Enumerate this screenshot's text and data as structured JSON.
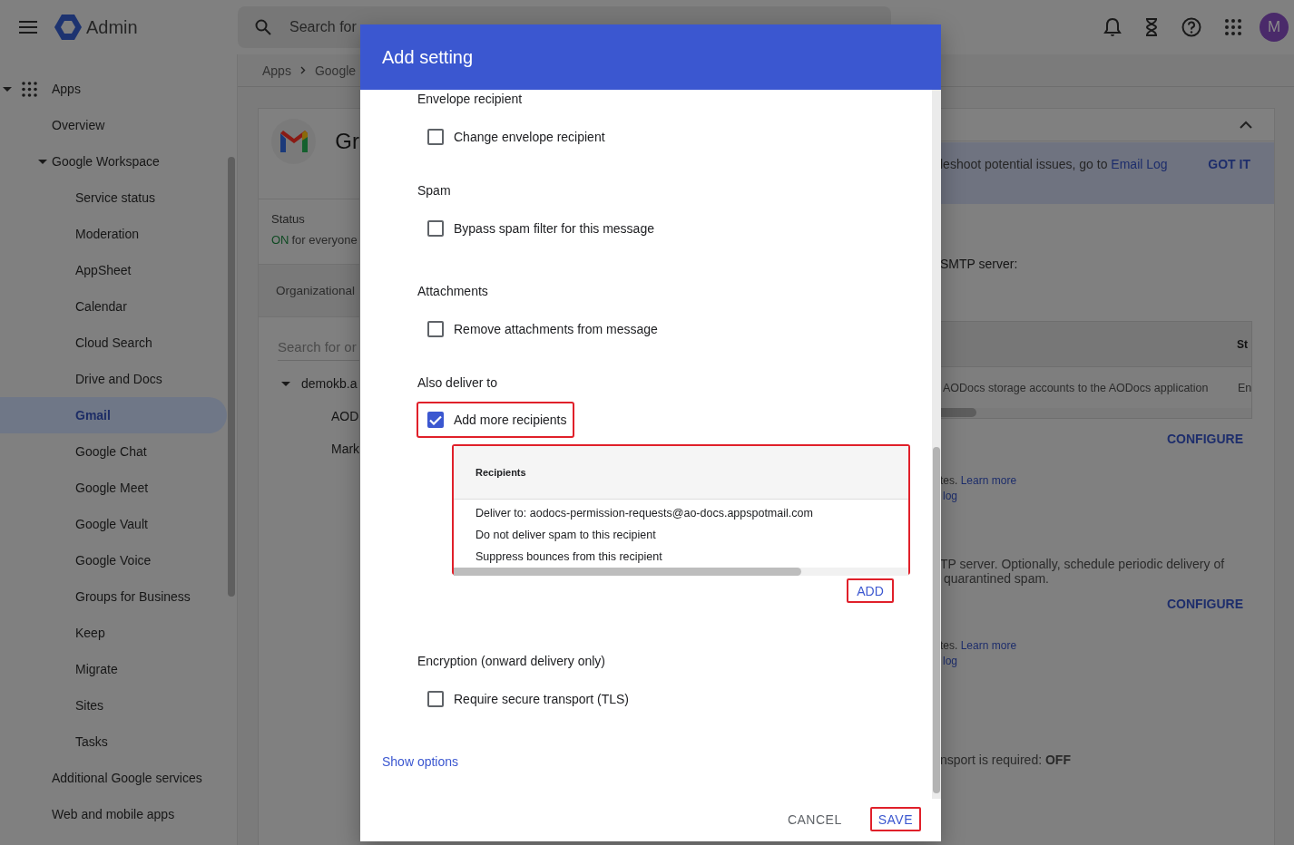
{
  "topbar": {
    "product": "Admin",
    "search": {
      "placeholder": "Search for"
    },
    "avatar": "M"
  },
  "sidebar": {
    "items": [
      {
        "label": "Apps",
        "expanded": true,
        "selected": false,
        "children": [
          {
            "label": "Overview",
            "selected": false
          },
          {
            "label": "Google Workspace",
            "expanded": true,
            "selected": false,
            "children": [
              {
                "label": "Service status",
                "selected": false
              },
              {
                "label": "Moderation",
                "selected": false
              },
              {
                "label": "AppSheet",
                "selected": false
              },
              {
                "label": "Calendar",
                "selected": false
              },
              {
                "label": "Cloud Search",
                "selected": false
              },
              {
                "label": "Drive and Docs",
                "selected": false
              },
              {
                "label": "Gmail",
                "selected": true
              },
              {
                "label": "Google Chat",
                "selected": false
              },
              {
                "label": "Google Meet",
                "selected": false
              },
              {
                "label": "Google Vault",
                "selected": false
              },
              {
                "label": "Google Voice",
                "selected": false
              },
              {
                "label": "Groups for Business",
                "selected": false
              },
              {
                "label": "Keep",
                "selected": false
              },
              {
                "label": "Migrate",
                "selected": false
              },
              {
                "label": "Sites",
                "selected": false
              },
              {
                "label": "Tasks",
                "selected": false
              }
            ]
          },
          {
            "label": "Additional Google services",
            "selected": false
          },
          {
            "label": "Web and mobile apps",
            "selected": false
          }
        ]
      }
    ]
  },
  "breadcrumb": [
    "Apps",
    "Google"
  ],
  "app": {
    "title": "Gr",
    "status": {
      "label": "Status",
      "state": "ON",
      "text": "for everyone"
    },
    "org_units": {
      "title": "Organizational",
      "search": {
        "placeholder": "Search for or"
      },
      "tree": [
        {
          "label": "demokb.a",
          "expanded": true,
          "children": [
            {
              "label": "AOD"
            },
            {
              "label": "Mark"
            }
          ]
        }
      ]
    }
  },
  "settings": {
    "banner": {
      "text": "leshoot potential issues, go to ",
      "link": "Email Log",
      "action": "GOT IT"
    },
    "smtp_label": "SMTP server:",
    "table": {
      "columns": [
        "",
        "St"
      ],
      "rows": [
        [
          "AODocs storage accounts to the AODocs application",
          "En"
        ]
      ]
    },
    "items": [
      {
        "kind": "action",
        "label": "CONFIGURE"
      },
      {
        "kind": "note",
        "text": "tes. ",
        "link": "Learn more",
        "second_link": "log"
      },
      {
        "kind": "text",
        "lines": [
          "TP server. Optionally, schedule periodic delivery of",
          "quarantined spam."
        ]
      },
      {
        "kind": "action",
        "label": "CONFIGURE"
      },
      {
        "kind": "note",
        "text": "tes. ",
        "link": "Learn more",
        "second_link": "log"
      },
      {
        "kind": "text",
        "lines": [
          "nsport is required: **OFF**"
        ]
      }
    ]
  },
  "dialog": {
    "title": "Add setting",
    "groups": [
      {
        "heading": "Envelope recipient",
        "option": {
          "label": "Change envelope recipient",
          "checked": false,
          "highlighted": false
        }
      },
      {
        "heading": "Spam",
        "option": {
          "label": "Bypass spam filter for this message",
          "checked": false,
          "highlighted": false
        }
      },
      {
        "heading": "Attachments",
        "option": {
          "label": "Remove attachments from message",
          "checked": false,
          "highlighted": false
        }
      },
      {
        "heading": "Also deliver to",
        "option": {
          "label": "Add more recipients",
          "checked": true,
          "highlighted": true
        },
        "recipients": {
          "header": "Recipients",
          "highlighted": true,
          "lines": [
            "Deliver to: aodocs-permission-requests@ao-docs.appspotmail.com",
            "Do not deliver spam to this recipient",
            "Suppress bounces from this recipient"
          ]
        },
        "add_button": {
          "label": "ADD",
          "highlighted": true
        }
      },
      {
        "heading": "Encryption (onward delivery only)",
        "option": {
          "label": "Require secure transport (TLS)",
          "checked": false,
          "highlighted": false
        }
      }
    ],
    "show_options": "Show options",
    "buttons": [
      {
        "label": "CANCEL",
        "highlighted": false
      },
      {
        "label": "SAVE",
        "highlighted": true
      }
    ]
  }
}
